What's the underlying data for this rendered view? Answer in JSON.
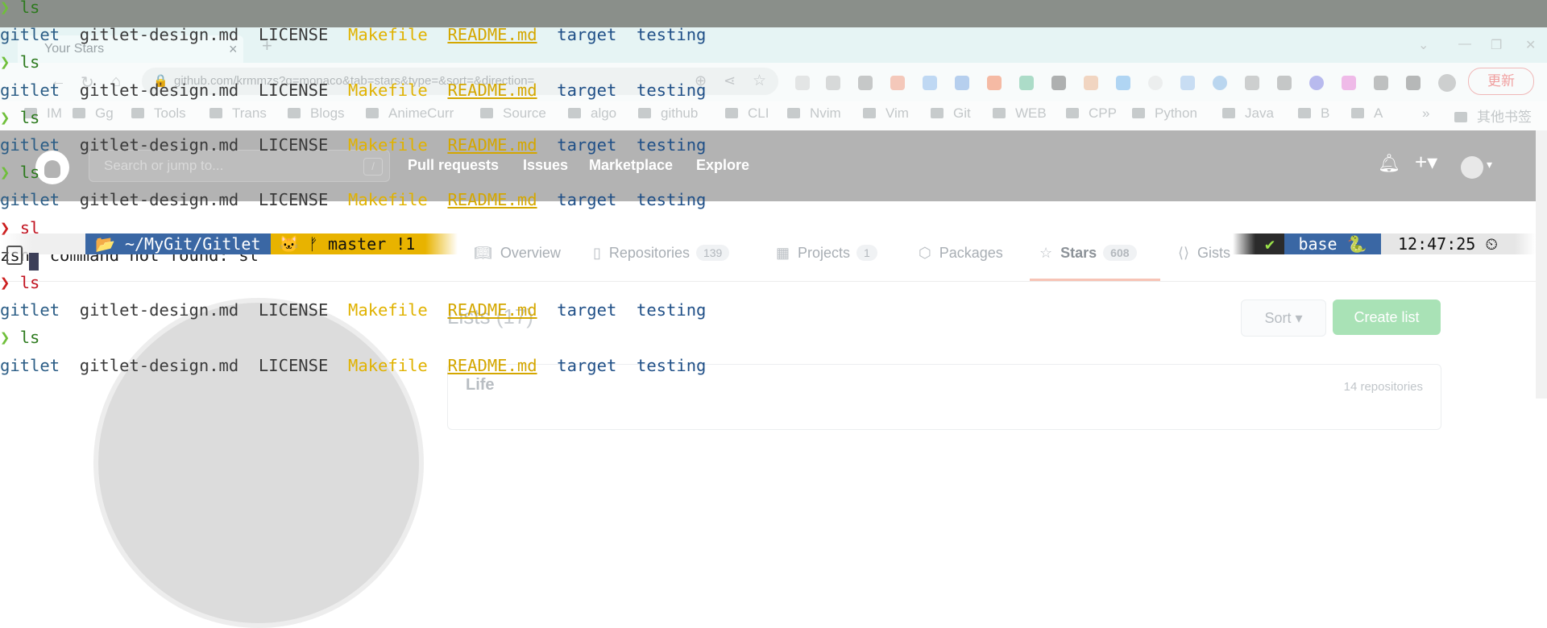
{
  "browser": {
    "tab_title": "Your Stars",
    "tab_close": "×",
    "new_tab": "+",
    "url": "github.com/krmmzs?q=monaco&tab=stars&type=&sort=&direction=",
    "update_button": "更新",
    "window_controls": [
      "⌄",
      "—",
      "❐",
      "✕"
    ],
    "bookmarks": [
      "IM",
      "Gg",
      "Tools",
      "Trans",
      "Blogs",
      "AnimeCurr",
      "Source",
      "algo",
      "github",
      "CLI",
      "Nvim",
      "Vim",
      "Git",
      "WEB",
      "CPP",
      "Python",
      "Java",
      "B",
      "A"
    ],
    "bookmarks_more": "»",
    "other_bookmarks": "其他书签"
  },
  "github": {
    "search_placeholder": "Search or jump to...",
    "search_key": "/",
    "nav": [
      "Pull requests",
      "Issues",
      "Marketplace",
      "Explore"
    ],
    "profile_tabs": [
      {
        "label": "Overview",
        "count": ""
      },
      {
        "label": "Repositories",
        "count": "139"
      },
      {
        "label": "Projects",
        "count": "1"
      },
      {
        "label": "Packages",
        "count": ""
      },
      {
        "label": "Stars",
        "count": "608"
      },
      {
        "label": "Gists",
        "count": ""
      }
    ],
    "lists_title": "Lists",
    "lists_count": "(17)",
    "sort_button": "Sort ▾",
    "create_list_button": "Create list",
    "first_list": {
      "name": "Life",
      "count": "14 repositories"
    }
  },
  "terminal": {
    "prompt_symbol": "❯",
    "ls_output": [
      "gitlet",
      "gitlet-design.md",
      "LICENSE",
      "Makefile",
      "README.md",
      "target",
      "testing"
    ],
    "lines": [
      {
        "type": "cmd",
        "status": "ok",
        "text": "ls"
      },
      {
        "type": "out"
      },
      {
        "type": "cmd",
        "status": "ok",
        "text": "ls"
      },
      {
        "type": "out"
      },
      {
        "type": "cmd",
        "status": "ok",
        "text": "ls"
      },
      {
        "type": "out"
      },
      {
        "type": "cmd",
        "status": "ok",
        "text": "ls"
      },
      {
        "type": "out"
      },
      {
        "type": "cmd",
        "status": "err",
        "text": "sl"
      },
      {
        "type": "text",
        "text": "zsh: command not found: sl"
      },
      {
        "type": "cmd",
        "status": "err",
        "text": "ls"
      },
      {
        "type": "out"
      },
      {
        "type": "cmd",
        "status": "ok",
        "text": "ls"
      },
      {
        "type": "out"
      }
    ],
    "statusline": {
      "os_icon": "",
      "dir": "📂 ~/MyGit/Gitlet",
      "git": "🐱 ᚠ master !1",
      "status_ok": "✔",
      "env": "base 🐍",
      "time": "12:47:25 ⏲"
    }
  },
  "colors": {
    "accent_green": "#6fbf3a",
    "error_red": "#cc1f1f",
    "dir_blue": "#3a67a4",
    "git_yellow": "#e8b300"
  }
}
